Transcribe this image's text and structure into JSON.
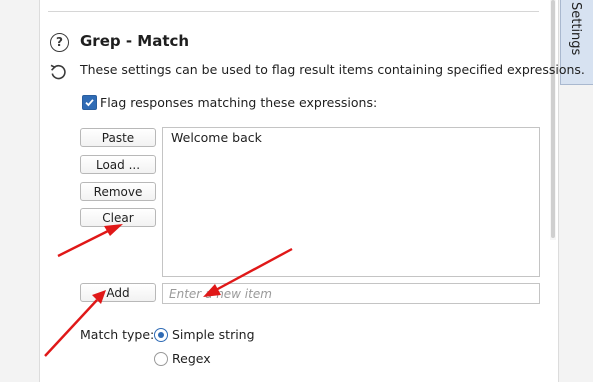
{
  "side_tab": {
    "label": "Settings"
  },
  "section": {
    "title": "Grep - Match",
    "description": "These settings can be used to flag result items containing specified expressions.",
    "help_icon": "help-circle-icon",
    "reset_icon": "reset-icon",
    "help_glyph": "?"
  },
  "flag_checkbox": {
    "label": "Flag responses matching these expressions:",
    "checked": true
  },
  "buttons": {
    "paste": "Paste",
    "load": "Load ...",
    "remove": "Remove",
    "clear": "Clear",
    "add": "Add"
  },
  "expressions": [
    "Welcome back"
  ],
  "new_item": {
    "placeholder": "Enter a new item",
    "value": ""
  },
  "match_type": {
    "label": "Match type:",
    "options": [
      "Simple string",
      "Regex"
    ],
    "selected": "Simple string"
  },
  "colors": {
    "accent": "#2f6bb5",
    "annotation": "#e01818",
    "tab_bg": "#d7e2f1"
  }
}
